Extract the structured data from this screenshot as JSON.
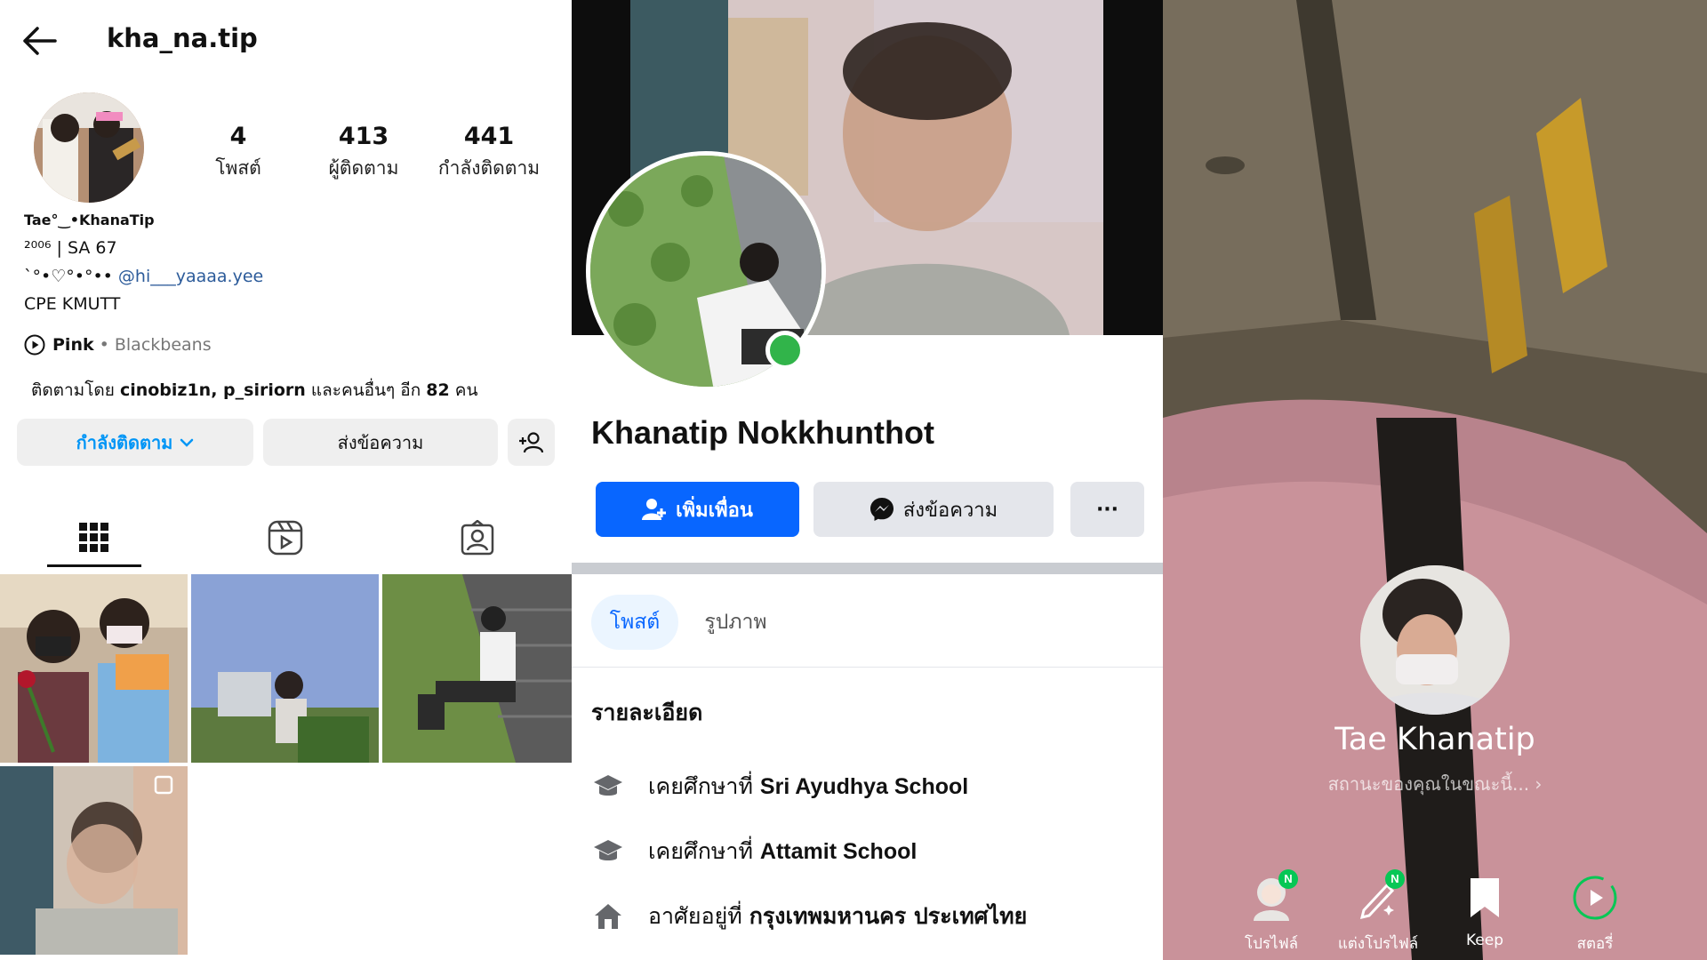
{
  "instagram": {
    "username": "kha_na.tip",
    "stats": [
      {
        "value": "4",
        "label": "โพสต์"
      },
      {
        "value": "413",
        "label": "ผู้ติดตาม"
      },
      {
        "value": "441",
        "label": "กำลังติดตาม"
      }
    ],
    "display_name": "Tae°‿•KhanaTip",
    "bio_year": "²⁰⁰⁶",
    "bio_sa": "| SA 67",
    "bio_deco": "`°•♡°•°••",
    "bio_mention": "@hi___yaaaa.yee",
    "bio_school": "CPE KMUTT",
    "music_song": "Pink",
    "music_artist": "• Blackbeans",
    "followed_prefix": "ติดตามโดย",
    "followed_names": "cinobiz1n, p_siriorn",
    "followed_middle": "และคนอื่นๆ อีก",
    "followed_count": "82",
    "followed_suffix": "คน",
    "btn_following": "กำลังติดตาม",
    "btn_message": "ส่งข้อความ",
    "accent_color": "#0095f6",
    "tabs": [
      "grid-icon",
      "reels-icon",
      "tagged-icon"
    ]
  },
  "facebook": {
    "name": "Khanatip Nokkhunthot",
    "btn_add_friend": "เพิ่มเพื่อน",
    "btn_message": "ส่งข้อความ",
    "btn_more": "···",
    "tab_posts": "โพสต์",
    "tab_photos": "รูปภาพ",
    "section_title": "รายละเอียด",
    "details": [
      {
        "prefix": "เคยศึกษาที่",
        "value": "Sri Ayudhya School",
        "icon": "graduation-cap-icon"
      },
      {
        "prefix": "เคยศึกษาที่",
        "value": "Attamit School",
        "icon": "graduation-cap-icon"
      },
      {
        "prefix": "อาศัยอยู่ที่",
        "value": "กรุงเทพมหานคร ประเทศไทย",
        "icon": "home-icon"
      }
    ],
    "brand_color": "#1877f2",
    "online_color": "#31b44a"
  },
  "line": {
    "name": "Tae Khanatip",
    "status_placeholder": "สถานะของคุณในขณะนี้... ›",
    "items": [
      {
        "label": "โปรไฟล์",
        "icon": "avatar-profile-icon",
        "badge": "N"
      },
      {
        "label": "แต่งโปรไฟล์",
        "icon": "edit-profile-icon",
        "badge": "N"
      },
      {
        "label": "Keep",
        "icon": "bookmark-icon",
        "badge": ""
      },
      {
        "label": "สตอรี่",
        "icon": "story-play-icon",
        "badge": ""
      }
    ],
    "badge_color": "#06c755"
  }
}
